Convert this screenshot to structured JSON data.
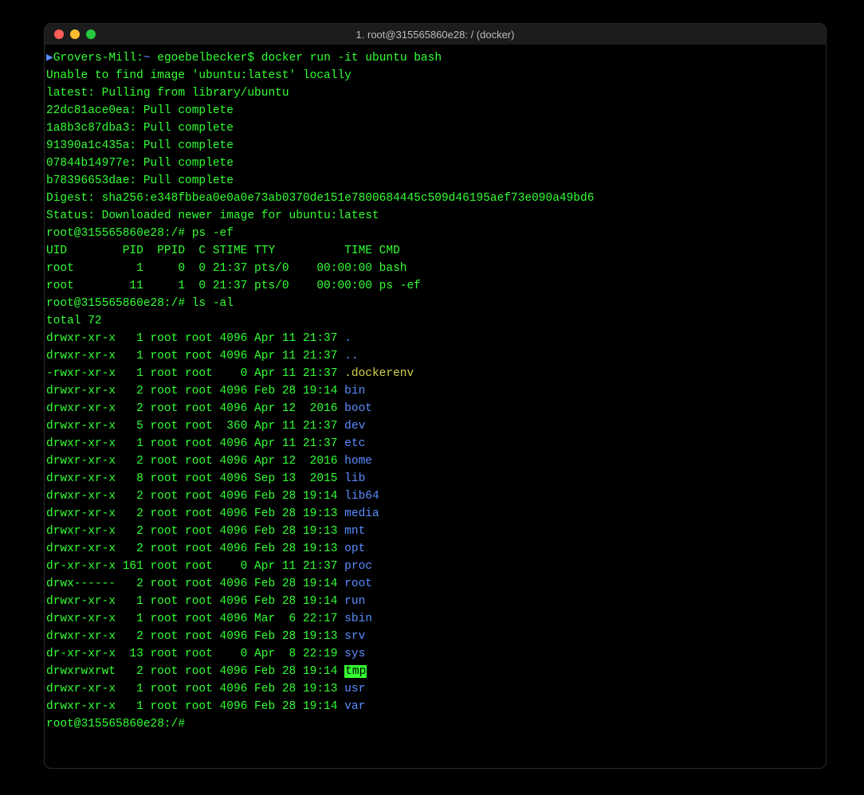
{
  "window": {
    "title": "1. root@315565860e28: / (docker)"
  },
  "session": {
    "host_prompt_host": "Grovers-Mill",
    "host_prompt_user": "egoebelbecker",
    "host_prompt_symbol": "$",
    "docker_command": "docker run -it ubuntu bash",
    "pull_lines": [
      "Unable to find image 'ubuntu:latest' locally",
      "latest: Pulling from library/ubuntu",
      "22dc81ace0ea: Pull complete",
      "1a8b3c87dba3: Pull complete",
      "91390a1c435a: Pull complete",
      "07844b14977e: Pull complete",
      "b78396653dae: Pull complete",
      "Digest: sha256:e348fbbea0e0a0e73ab0370de151e7800684445c509d46195aef73e090a49bd6",
      "Status: Downloaded newer image for ubuntu:latest"
    ],
    "container_prompt": "root@315565860e28:/#",
    "ps_command": "ps -ef",
    "ps_header": "UID        PID  PPID  C STIME TTY          TIME CMD",
    "ps_rows": [
      "root         1     0  0 21:37 pts/0    00:00:00 bash",
      "root        11     1  0 21:37 pts/0    00:00:00 ps -ef"
    ],
    "ls_command": "ls -al",
    "ls_total": "total 72",
    "ls_entries": [
      {
        "meta": "drwxr-xr-x   1 root root 4096 Apr 11 21:37 ",
        "name": ".",
        "class": "blue"
      },
      {
        "meta": "drwxr-xr-x   1 root root 4096 Apr 11 21:37 ",
        "name": "..",
        "class": "blue"
      },
      {
        "meta": "-rwxr-xr-x   1 root root    0 Apr 11 21:37 ",
        "name": ".dockerenv",
        "class": "yellow"
      },
      {
        "meta": "drwxr-xr-x   2 root root 4096 Feb 28 19:14 ",
        "name": "bin",
        "class": "blue"
      },
      {
        "meta": "drwxr-xr-x   2 root root 4096 Apr 12  2016 ",
        "name": "boot",
        "class": "blue"
      },
      {
        "meta": "drwxr-xr-x   5 root root  360 Apr 11 21:37 ",
        "name": "dev",
        "class": "blue"
      },
      {
        "meta": "drwxr-xr-x   1 root root 4096 Apr 11 21:37 ",
        "name": "etc",
        "class": "blue"
      },
      {
        "meta": "drwxr-xr-x   2 root root 4096 Apr 12  2016 ",
        "name": "home",
        "class": "blue"
      },
      {
        "meta": "drwxr-xr-x   8 root root 4096 Sep 13  2015 ",
        "name": "lib",
        "class": "blue"
      },
      {
        "meta": "drwxr-xr-x   2 root root 4096 Feb 28 19:14 ",
        "name": "lib64",
        "class": "blue"
      },
      {
        "meta": "drwxr-xr-x   2 root root 4096 Feb 28 19:13 ",
        "name": "media",
        "class": "blue"
      },
      {
        "meta": "drwxr-xr-x   2 root root 4096 Feb 28 19:13 ",
        "name": "mnt",
        "class": "blue"
      },
      {
        "meta": "drwxr-xr-x   2 root root 4096 Feb 28 19:13 ",
        "name": "opt",
        "class": "blue"
      },
      {
        "meta": "dr-xr-xr-x 161 root root    0 Apr 11 21:37 ",
        "name": "proc",
        "class": "blue"
      },
      {
        "meta": "drwx------   2 root root 4096 Feb 28 19:14 ",
        "name": "root",
        "class": "blue"
      },
      {
        "meta": "drwxr-xr-x   1 root root 4096 Feb 28 19:14 ",
        "name": "run",
        "class": "blue"
      },
      {
        "meta": "drwxr-xr-x   1 root root 4096 Mar  6 22:17 ",
        "name": "sbin",
        "class": "blue"
      },
      {
        "meta": "drwxr-xr-x   2 root root 4096 Feb 28 19:13 ",
        "name": "srv",
        "class": "blue"
      },
      {
        "meta": "dr-xr-xr-x  13 root root    0 Apr  8 22:19 ",
        "name": "sys",
        "class": "blue"
      },
      {
        "meta": "drwxrwxrwt   2 root root 4096 Feb 28 19:14 ",
        "name": "tmp",
        "class": "tmp-highlight"
      },
      {
        "meta": "drwxr-xr-x   1 root root 4096 Feb 28 19:13 ",
        "name": "usr",
        "class": "blue"
      },
      {
        "meta": "drwxr-xr-x   1 root root 4096 Feb 28 19:14 ",
        "name": "var",
        "class": "blue"
      }
    ]
  }
}
